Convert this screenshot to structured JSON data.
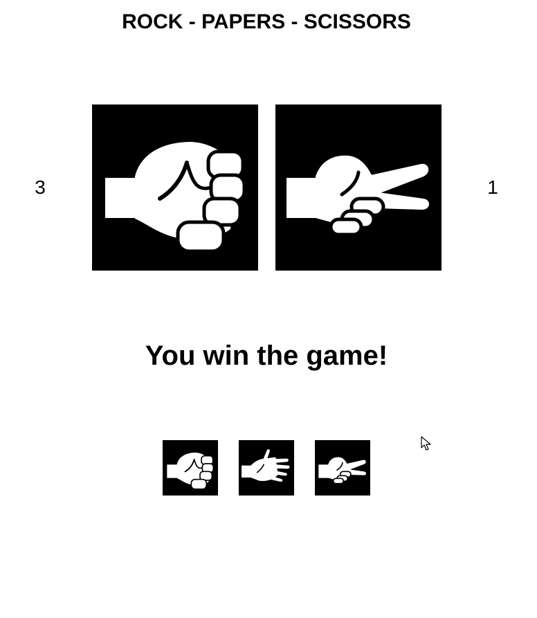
{
  "title": "ROCK - PAPERS - SCISSORS",
  "scores": {
    "player": "3",
    "computer": "1"
  },
  "round": {
    "player_choice": "rock",
    "computer_choice": "scissors"
  },
  "result_text": "You win the game!",
  "choices": [
    {
      "id": "rock",
      "icon": "rock-hand-icon"
    },
    {
      "id": "paper",
      "icon": "paper-hand-icon"
    },
    {
      "id": "scissors",
      "icon": "scissors-hand-icon"
    }
  ],
  "colors": {
    "tile_background": "#000000",
    "hand_fill": "#ffffff",
    "page_background": "#ffffff"
  }
}
